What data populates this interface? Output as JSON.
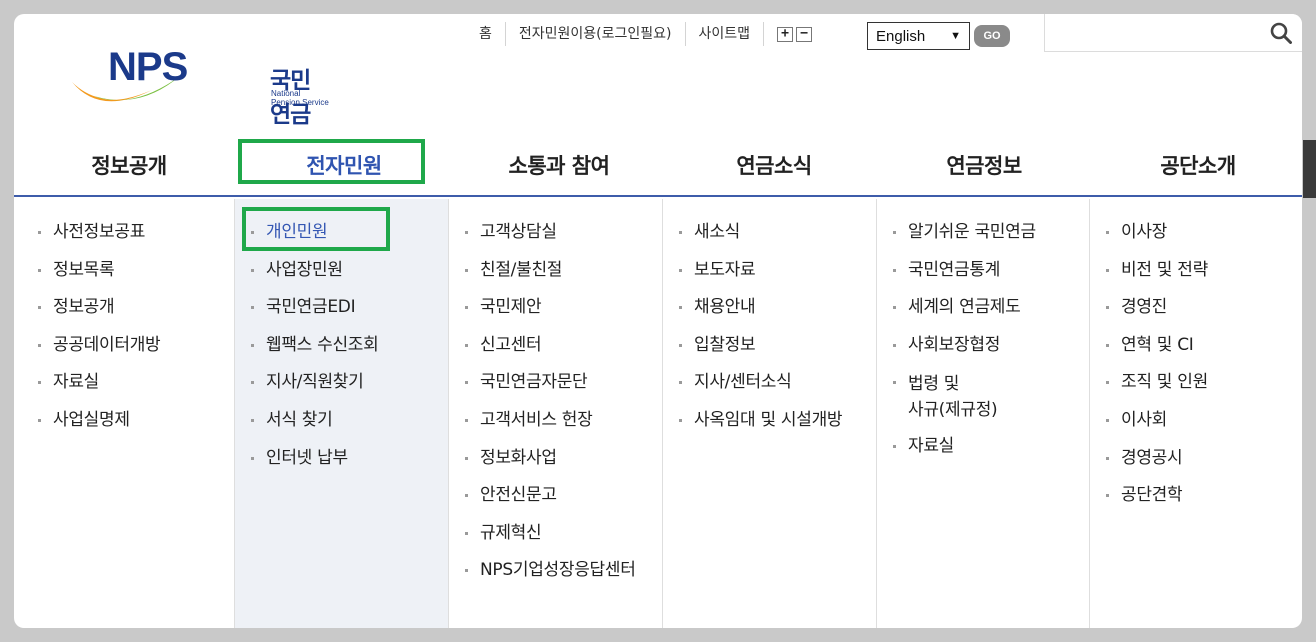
{
  "logo": {
    "text": "NPS",
    "name_ko": "국민연금",
    "name_en": "National Pension Service"
  },
  "utility": {
    "links": [
      "홈",
      "전자민원이용(로그인필요)",
      "사이트맵"
    ],
    "font_increase": "+",
    "font_decrease": "−",
    "language": "English",
    "go": "GO"
  },
  "search": {
    "placeholder": "",
    "icon": "search-icon"
  },
  "gnb": {
    "items": [
      "정보공개",
      "전자민원",
      "소통과 참여",
      "연금소식",
      "연금정보",
      "공단소개"
    ],
    "active_index": 1
  },
  "submenu": {
    "columns": [
      [
        "사전정보공표",
        "정보목록",
        "정보공개",
        "공공데이터개방",
        "자료실",
        "사업실명제"
      ],
      [
        "개인민원",
        "사업장민원",
        "국민연금EDI",
        "웹팩스 수신조회",
        "지사/직원찾기",
        "서식 찾기",
        "인터넷 납부"
      ],
      [
        "고객상담실",
        "친절/불친절",
        "국민제안",
        "신고센터",
        "국민연금자문단",
        "고객서비스 헌장",
        "정보화사업",
        "안전신문고",
        "규제혁신",
        "NPS기업성장응답센터"
      ],
      [
        "새소식",
        "보도자료",
        "채용안내",
        "입찰정보",
        "지사/센터소식",
        "사옥임대 및 시설개방"
      ],
      [
        "알기쉬운 국민연금",
        "국민연금통계",
        "세계의 연금제도",
        "사회보장협정",
        "법령 및\n사규(제규정)",
        "자료실"
      ],
      [
        "이사장",
        "비전 및 전략",
        "경영진",
        "연혁 및 CI",
        "조직 및 인원",
        "이사회",
        "경영공시",
        "공단견학"
      ]
    ],
    "selected_item": "개인민원"
  },
  "colors": {
    "brand_blue": "#1b3a8a",
    "active_blue": "#2f54b0",
    "highlight_green": "#1fa84a",
    "active_column_bg": "#eef1f6"
  }
}
